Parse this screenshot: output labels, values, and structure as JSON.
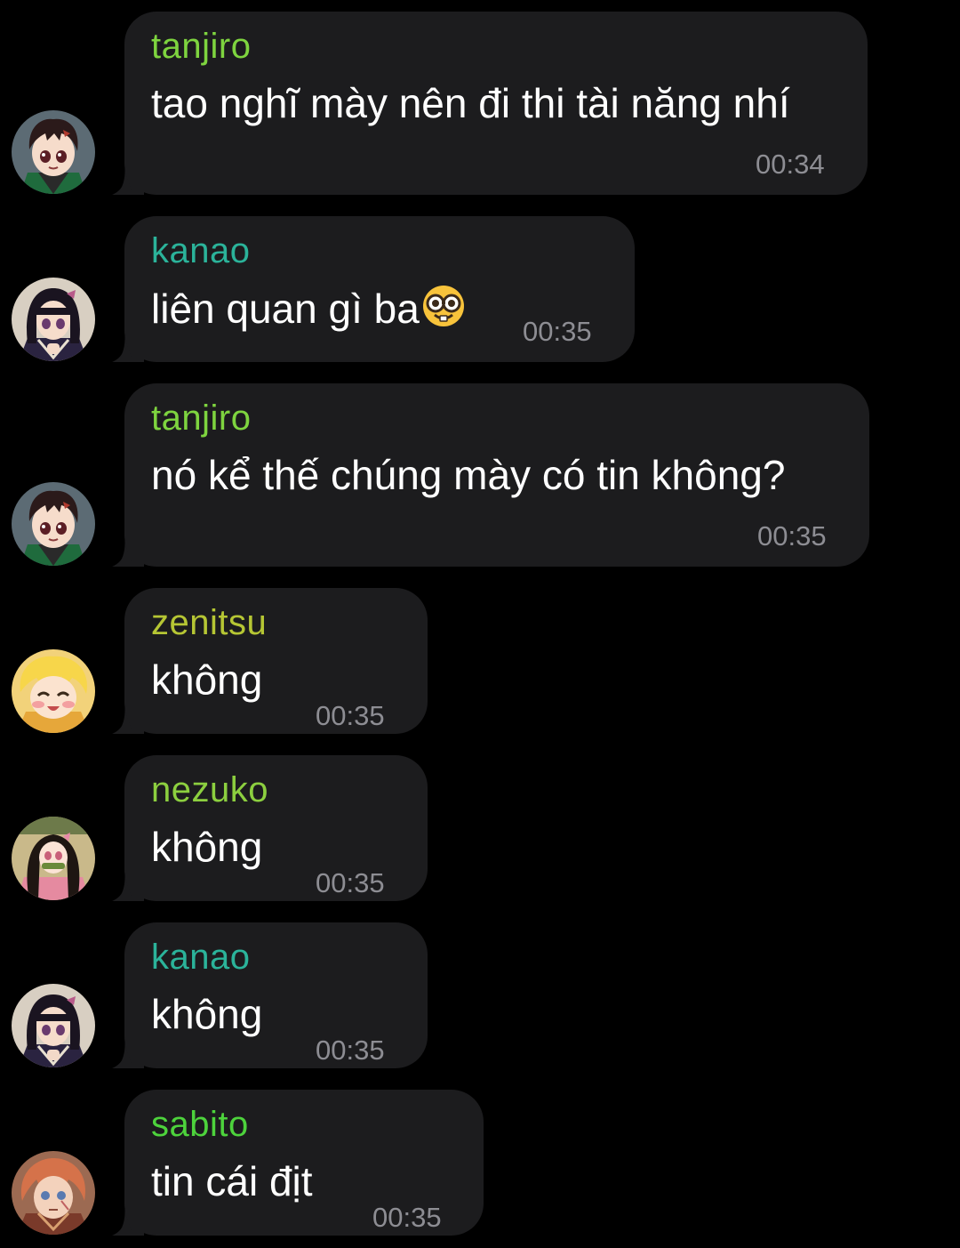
{
  "colors": {
    "background": "#000000",
    "bubble": "#1c1c1e",
    "text": "#ffffff",
    "timestamp": "#8d8d93"
  },
  "messages": [
    {
      "sender": "tanjiro",
      "sender_color": "#7ed43f",
      "text": "tao nghĩ mày nên đi thi tài năng nhí",
      "time": "00:34",
      "avatar": "tanjiro-avatar"
    },
    {
      "sender": "kanao",
      "sender_color": "#2bb39a",
      "text": "liên quan gì ba",
      "emoji": "nerd-face-emoji",
      "time": "00:35",
      "avatar": "kanao-avatar"
    },
    {
      "sender": "tanjiro",
      "sender_color": "#7ed43f",
      "text": "nó kể thế chúng mày có tin không?",
      "time": "00:35",
      "avatar": "tanjiro-avatar"
    },
    {
      "sender": "zenitsu",
      "sender_color": "#b6c634",
      "text": "không",
      "time": "00:35",
      "avatar": "zenitsu-avatar"
    },
    {
      "sender": "nezuko",
      "sender_color": "#8ccf3f",
      "text": "không",
      "time": "00:35",
      "avatar": "nezuko-avatar"
    },
    {
      "sender": "kanao",
      "sender_color": "#2bb39a",
      "text": "không",
      "time": "00:35",
      "avatar": "kanao-avatar"
    },
    {
      "sender": "sabito",
      "sender_color": "#4dd33c",
      "text": "tin cái địt",
      "time": "00:35",
      "avatar": "sabito-avatar"
    }
  ]
}
